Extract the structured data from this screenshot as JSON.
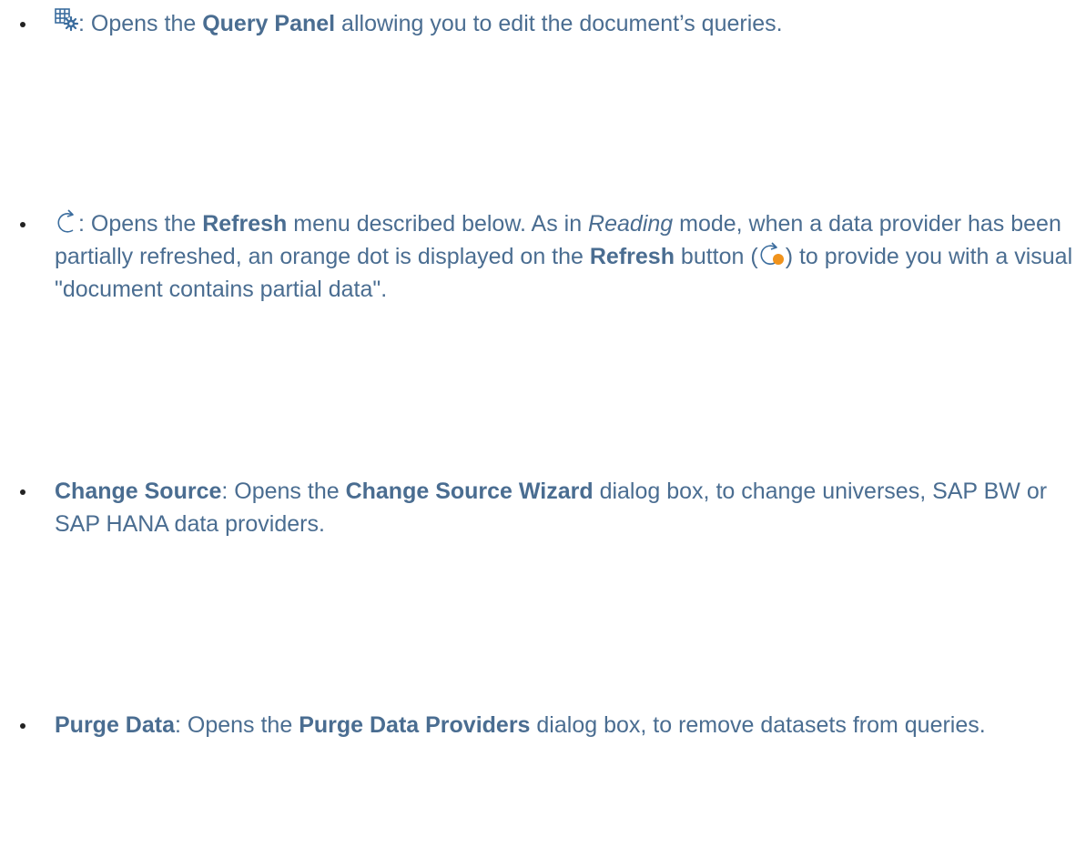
{
  "colors": {
    "text": "#4a6d91",
    "icon": "#3b6d9e",
    "orange_dot": "#f0931c",
    "bullet": "#222222"
  },
  "items": [
    {
      "icon": "query-panel-icon",
      "sep": ": Opens the ",
      "strong1": "Query Panel",
      "rest1": " allowing you to edit the document’s queries."
    },
    {
      "icon": "refresh-icon",
      "sep": ": Opens the ",
      "strong1": "Refresh",
      "mid1": " menu described below. As in ",
      "em1": "Reading",
      "mid2": " mode, when a data provider has been partially refreshed, an orange dot is displayed on the ",
      "strong2": "Refresh",
      "mid3": " button (",
      "inline_icon": "refresh-partial-icon",
      "mid4": ") to provide you with a visual \"document contains partial data\"."
    },
    {
      "strong1": "Change Source",
      "mid1": ": Opens the ",
      "strong2": "Change Source Wizard",
      "rest1": " dialog box, to change universes, SAP BW or SAP HANA data providers."
    },
    {
      "strong1": "Purge Data",
      "mid1": ": Opens the ",
      "strong2": "Purge Data Providers",
      "rest1": " dialog box, to remove datasets from queries."
    }
  ]
}
